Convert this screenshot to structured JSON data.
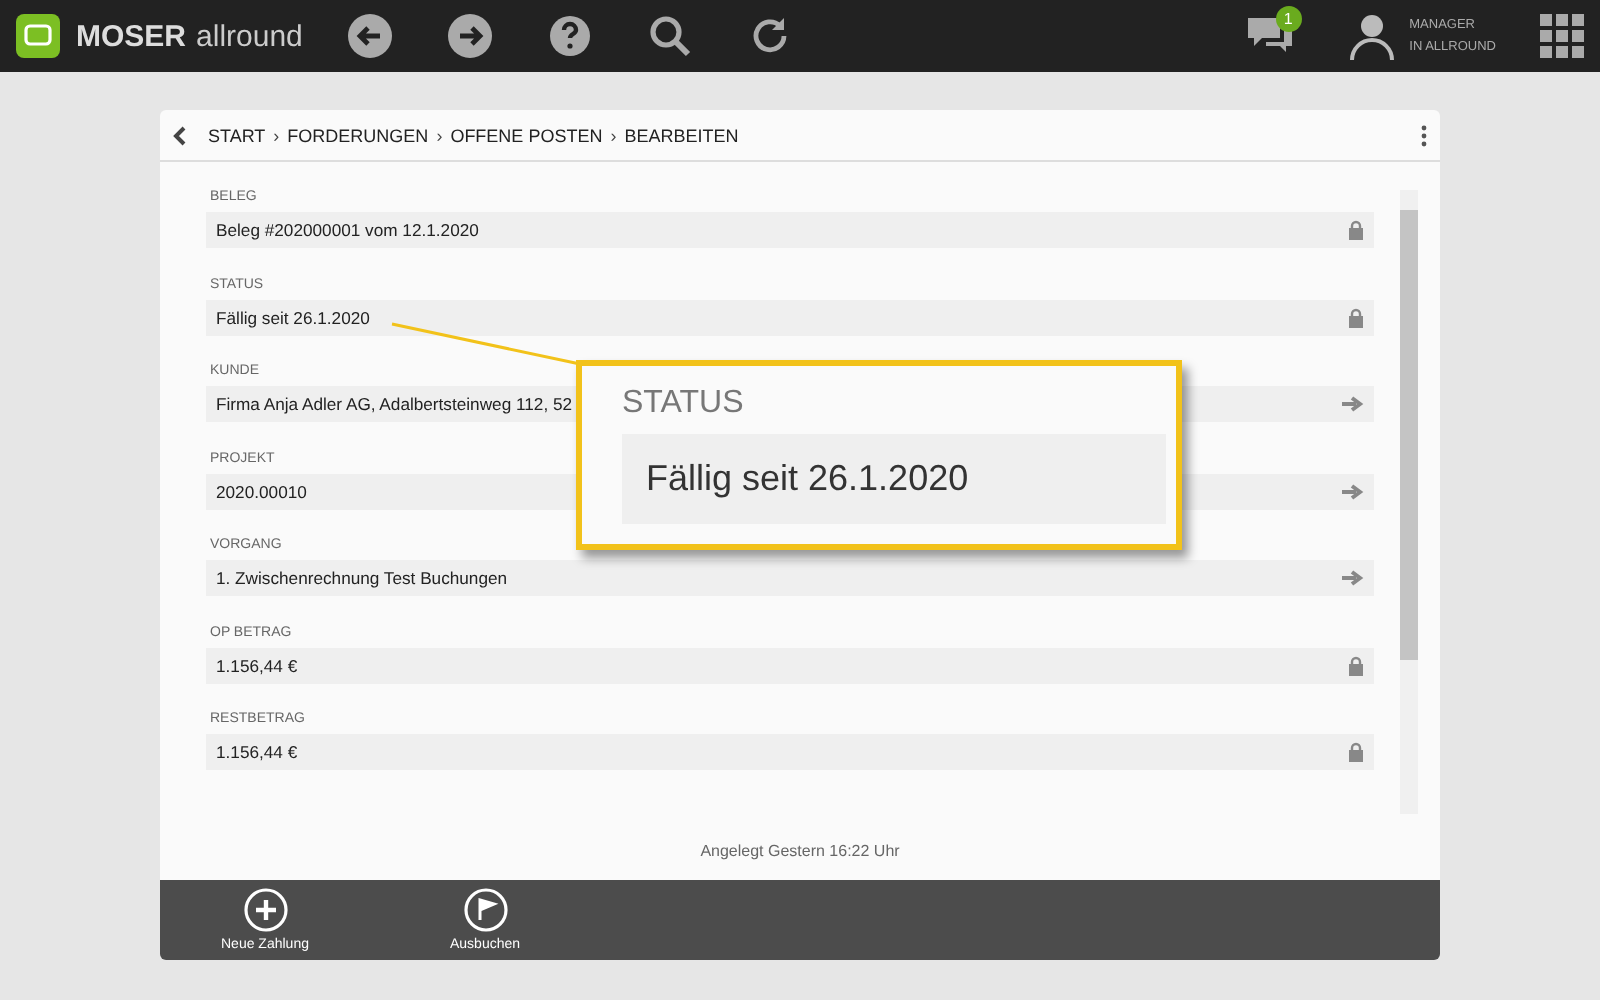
{
  "app": {
    "brand_bold": "MOSER",
    "brand_light": "allround",
    "notifications": "1",
    "user_line_1": "MANAGER",
    "user_line_2": "IN ALLROUND"
  },
  "breadcrumb": [
    "START",
    "FORDERUNGEN",
    "OFFENE POSTEN",
    "BEARBEITEN"
  ],
  "breadcrumb_separator": "›",
  "fields": [
    {
      "label": "BELEG",
      "value": "Beleg #202000001 vom 12.1.2020",
      "kind": "locked"
    },
    {
      "label": "STATUS",
      "value": "Fällig seit 26.1.2020",
      "kind": "locked"
    },
    {
      "label": "KUNDE",
      "value": "Firma Anja Adler AG, Adalbertsteinweg 112, 52",
      "kind": "link"
    },
    {
      "label": "PROJEKT",
      "value": "2020.00010",
      "kind": "link"
    },
    {
      "label": "VORGANG",
      "value": "1. Zwischenrechnung Test Buchungen",
      "kind": "link"
    },
    {
      "label": "OP BETRAG",
      "value": "1.156,44 €",
      "kind": "locked"
    },
    {
      "label": "RESTBETRAG",
      "value": "1.156,44 €",
      "kind": "locked"
    }
  ],
  "callout": {
    "label": "STATUS",
    "value": "Fällig seit 26.1.2020"
  },
  "created": "Angelegt Gestern 16:22 Uhr",
  "actions": [
    {
      "label": "Neue Zahlung",
      "kind": "add"
    },
    {
      "label": "Ausbuchen",
      "kind": "flag"
    }
  ]
}
